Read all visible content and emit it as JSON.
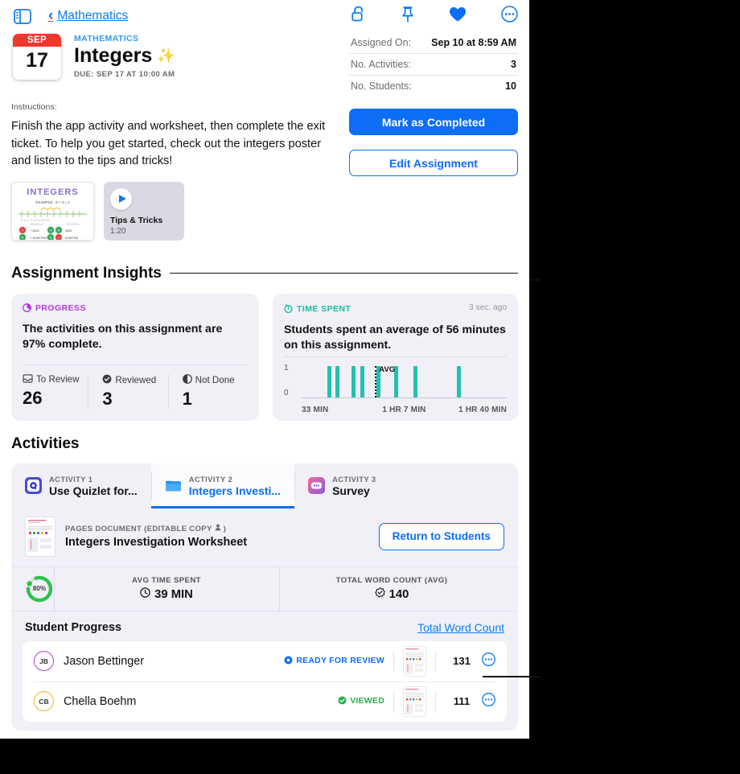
{
  "topbar": {
    "sidebar_toggle": "sidebar-toggle-icon",
    "back_label": "Mathematics",
    "icons": [
      {
        "name": "unlock-icon",
        "label": "Unlock"
      },
      {
        "name": "pin-icon",
        "label": "Pin"
      },
      {
        "name": "heart-icon",
        "label": "Favorite"
      },
      {
        "name": "more-circle-icon",
        "label": "More"
      }
    ]
  },
  "header": {
    "date_month": "SEP",
    "date_day": "17",
    "kicker": "MATHEMATICS",
    "title": "Integers",
    "sparkle": "✨",
    "due": "DUE: SEP 17 AT 10:00 AM",
    "meta": [
      {
        "key": "Assigned On:",
        "value": "Sep 10 at 8:59 AM"
      },
      {
        "key": "No. Activities:",
        "value": "3"
      },
      {
        "key": "No. Students:",
        "value": "10"
      }
    ]
  },
  "instructions": {
    "label": "Instructions:",
    "body": "Finish the app activity and worksheet, then complete the exit ticket. To help you get started, check out the integers poster and listen to the tips and tricks!",
    "poster": {
      "name": "integers-poster-thumbnail",
      "title": "INTEGERS",
      "example": "EXAMPLE: -3 + 4 = 1"
    },
    "video": {
      "title": "Tips & Tricks",
      "duration": "1:20"
    }
  },
  "actions": {
    "primary": "Mark as Completed",
    "secondary": "Edit Assignment"
  },
  "insights": {
    "section_title": "Assignment Insights",
    "progress": {
      "caption": "PROGRESS",
      "caption_color": "#b43bd8",
      "headline": "The activities on this assignment are 97% complete.",
      "percent": "97%",
      "stats": [
        {
          "label": "To Review",
          "value": "26",
          "icon": "tray-icon"
        },
        {
          "label": "Reviewed",
          "value": "3",
          "icon": "check-circle-icon"
        },
        {
          "label": "Not Done",
          "value": "1",
          "icon": "half-circle-icon"
        }
      ]
    },
    "time": {
      "caption": "TIME SPENT",
      "caption_color": "#13bfa6",
      "ago": "3 sec. ago",
      "headline": "Students spent an average of 56 minutes on this assignment.",
      "avg_label": "AVG"
    }
  },
  "chart_data": {
    "type": "bar",
    "title": "Time Spent",
    "subtitle": "Students spent an average of 56 minutes on this assignment.",
    "xlabel": "",
    "ylabel": "",
    "ylim": [
      0,
      1
    ],
    "ytick_labels": [
      "0",
      "1"
    ],
    "xtick_labels": [
      "33 MIN",
      "1 HR 7 MIN",
      "1 HR 40 MIN"
    ],
    "xtick_positions_pct": [
      0,
      50,
      100
    ],
    "grid": false,
    "legend": false,
    "bar_color": "#1fc2ad",
    "annotation": {
      "label": "AVG",
      "position_pct": 35.5,
      "style": "dotted-vertical-line"
    },
    "categories": [
      "b1",
      "b2",
      "b3",
      "b4",
      "b5",
      "b6",
      "b7",
      "b8",
      "b9",
      "b10"
    ],
    "bar_positions_pct": [
      12.5,
      16.5,
      24.5,
      28.5,
      36.5,
      45.0,
      54.5,
      75.5
    ],
    "values": [
      1,
      1,
      1,
      1,
      1,
      1,
      1,
      1
    ]
  },
  "activities": {
    "section_title": "Activities",
    "tabs": [
      {
        "kicker": "ACTIVITY 1",
        "label": "Use Quizlet for...",
        "icon": "quizlet-app-icon",
        "active": false
      },
      {
        "kicker": "ACTIVITY 2",
        "label": "Integers Investi...",
        "icon": "pages-document-icon",
        "active": true
      },
      {
        "kicker": "ACTIVITY 3",
        "label": "Survey",
        "icon": "survey-app-icon",
        "active": false
      }
    ],
    "document": {
      "kind": "PAGES DOCUMENT (EDITABLE COPY",
      "kind_suffix": ")",
      "title": "Integers Investigation Worksheet",
      "return_button": "Return to Students"
    },
    "metrics": {
      "ring_percent": "80%",
      "ring_value": 80,
      "items": [
        {
          "key": "AVG TIME SPENT",
          "value": "39 MIN",
          "icon": "clock-icon"
        },
        {
          "key": "TOTAL WORD COUNT (AVG)",
          "value": "140",
          "icon": "check-badge-icon"
        }
      ]
    },
    "student_progress": {
      "title": "Student Progress",
      "link": "Total Word Count",
      "rows": [
        {
          "initials": "JB",
          "name": "Jason Bettinger",
          "avatar_color": "#b43bd8",
          "status": "READY FOR REVIEW",
          "status_color": "#0b6ef5",
          "status_icon": "target-dot-icon",
          "word_count": "131"
        },
        {
          "initials": "CB",
          "name": "Chella Boehm",
          "avatar_color": "#f0b41c",
          "status": "VIEWED",
          "status_color": "#24b24a",
          "status_icon": "check-circle-icon",
          "word_count": "111"
        }
      ]
    }
  }
}
